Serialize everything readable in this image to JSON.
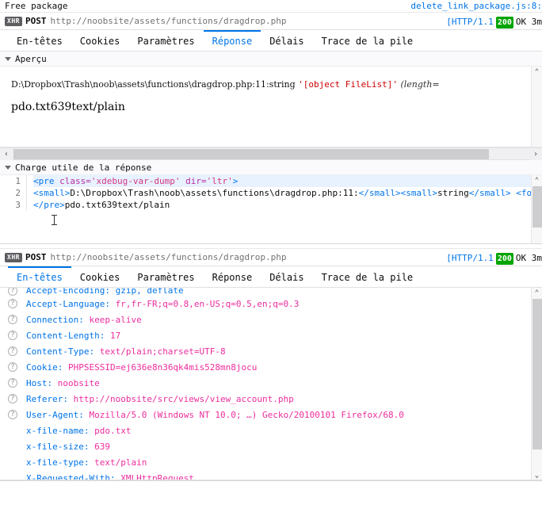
{
  "console": {
    "message": "Free package",
    "source": "delete_link_package.js:8:"
  },
  "request_top": {
    "type_badge": "XHR",
    "method": "POST",
    "url": "http://noobsite/assets/functions/dragdrop.php",
    "protocol": "[HTTP/1.1",
    "status_code": "200",
    "status_text": "OK 3m"
  },
  "request_bottom": {
    "type_badge": "XHR",
    "method": "POST",
    "url": "http://noobsite/assets/functions/dragdrop.php",
    "protocol": "[HTTP/1.1",
    "status_code": "200",
    "status_text": "OK 3m"
  },
  "tabs_top": [
    {
      "label": "En-têtes",
      "active": false
    },
    {
      "label": "Cookies",
      "active": false
    },
    {
      "label": "Paramètres",
      "active": false
    },
    {
      "label": "Réponse",
      "active": true
    },
    {
      "label": "Délais",
      "active": false
    },
    {
      "label": "Trace de la pile",
      "active": false
    }
  ],
  "tabs_bottom": [
    {
      "label": "En-têtes",
      "active": true
    },
    {
      "label": "Cookies",
      "active": false
    },
    {
      "label": "Paramètres",
      "active": false
    },
    {
      "label": "Réponse",
      "active": false
    },
    {
      "label": "Délais",
      "active": false
    },
    {
      "label": "Trace de la pile",
      "active": false
    }
  ],
  "preview": {
    "section_title": "Aperçu",
    "dump_path": "D:\\Dropbox\\Trash\\noob\\assets\\functions\\dragdrop.php:11:string ",
    "dump_string": "'[object FileList]'",
    "dump_length": " (length=",
    "plain_text": "pdo.txt639text/plain"
  },
  "payload": {
    "section_title": "Charge utile de la réponse",
    "line_numbers": [
      "1",
      "2",
      "3"
    ],
    "line1": {
      "tag_open": "<pre ",
      "attr1_name": "class=",
      "attr1_value": "'xdebug-var-dump'",
      "attr2_name": " dir=",
      "attr2_value": "'ltr'",
      "tag_close": ">"
    },
    "line2": {
      "small_open": "<small>",
      "path": "D:\\Dropbox\\Trash\\noob\\assets\\functions\\dragdrop.php:11:",
      "small_close": "</small>",
      "small_open2": "<small>",
      "type": "string",
      "small_close2": "</small>",
      "font_open": " <font cc"
    },
    "line3": {
      "pre_close": "</pre>",
      "text": "pdo.txt639text/plain"
    }
  },
  "headers": {
    "clipped_first": "Accept-Encoding: gzip, deflate",
    "rows": [
      {
        "icon": "help-icon",
        "name": "Accept-Language:",
        "value": "fr,fr-FR;q=0.8,en-US;q=0.5,en;q=0.3"
      },
      {
        "icon": "help-icon",
        "name": "Connection:",
        "value": "keep-alive"
      },
      {
        "icon": "help-icon",
        "name": "Content-Length:",
        "value": "17"
      },
      {
        "icon": "help-icon",
        "name": "Content-Type:",
        "value": "text/plain;charset=UTF-8"
      },
      {
        "icon": "help-icon",
        "name": "Cookie:",
        "value": "PHPSESSID=ej636e8n36qk4mis528mn8jocu"
      },
      {
        "icon": "help-icon",
        "name": "Host:",
        "value": "noobsite"
      },
      {
        "icon": "help-icon",
        "name": "Referer:",
        "value": "http://noobsite/src/views/view_account.php"
      },
      {
        "icon": "help-icon",
        "name": "User-Agent:",
        "value": "Mozilla/5.0 (Windows NT 10.0; …) Gecko/20100101 Firefox/68.0"
      },
      {
        "icon": "none",
        "name": "x-file-name:",
        "value": "pdo.txt"
      },
      {
        "icon": "none",
        "name": "x-file-size:",
        "value": "639"
      },
      {
        "icon": "none",
        "name": "x-file-type:",
        "value": "text/plain"
      },
      {
        "icon": "none",
        "name": "X-Requested-With:",
        "value": "XMLHttpRequest"
      }
    ]
  },
  "icons": {
    "twisty": "triangle-down-icon",
    "scroll_left": "‹",
    "scroll_right": "›",
    "scroll_up": "⌃",
    "scroll_down": "⌄",
    "help": "?"
  },
  "colors": {
    "accent": "#0074e8",
    "status_ok": "#00a400",
    "header_name": "#0074e8",
    "header_value": "#ed2d9e",
    "string_red": "#cc0000"
  }
}
